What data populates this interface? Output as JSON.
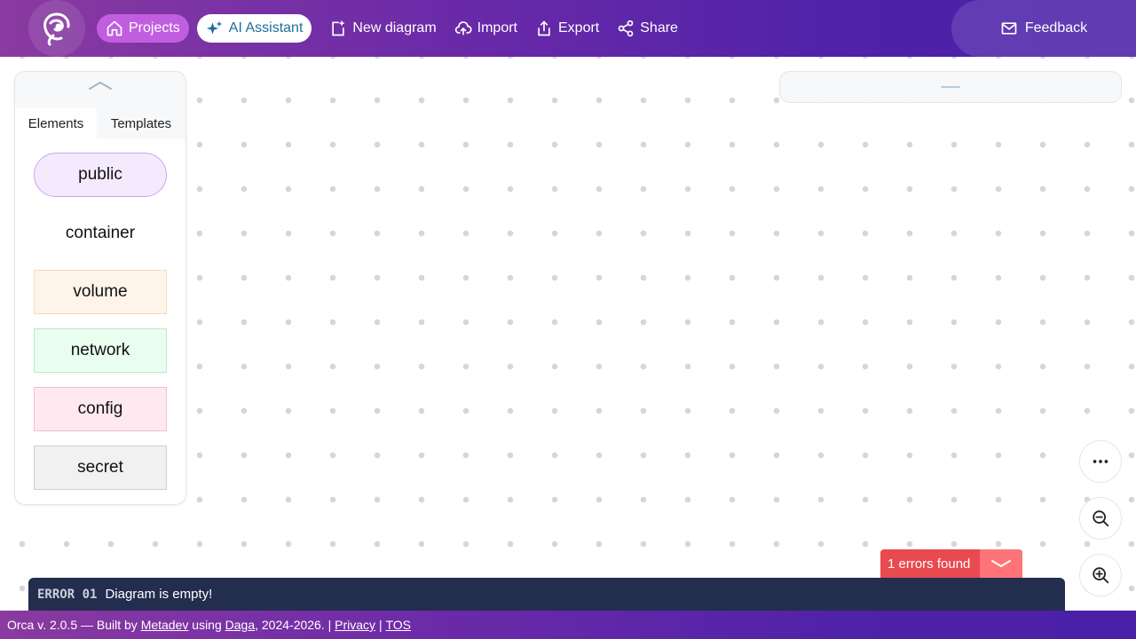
{
  "app": {
    "accent_top": "#8a3aa0",
    "accent_bottom": "#4a20a8"
  },
  "topbar": {
    "logo_icon": "orca-logo-icon",
    "projects_label": "Projects",
    "ai_label": "AI Assistant",
    "new_diagram_label": "New diagram",
    "import_label": "Import",
    "export_label": "Export",
    "share_label": "Share",
    "feedback_label": "Feedback"
  },
  "palette": {
    "tabs": [
      {
        "label": "Elements",
        "active": true
      },
      {
        "label": "Templates",
        "active": false
      }
    ],
    "elements": [
      {
        "label": "public"
      },
      {
        "label": "container"
      },
      {
        "label": "volume"
      },
      {
        "label": "network"
      },
      {
        "label": "config"
      },
      {
        "label": "secret"
      }
    ]
  },
  "errors": {
    "summary": "1 errors found",
    "items": [
      {
        "code": "ERROR 01",
        "message": "Diagram is empty!"
      }
    ],
    "badge_color": "#e84a50"
  },
  "footer": {
    "prefix": "Orca v. 2.0.5 — Built by ",
    "metadev": "Metadev",
    "using": " using ",
    "daga": "Daga",
    "years": ", 2024-2026. | ",
    "privacy": "Privacy",
    "sep": " | ",
    "tos": "TOS"
  }
}
